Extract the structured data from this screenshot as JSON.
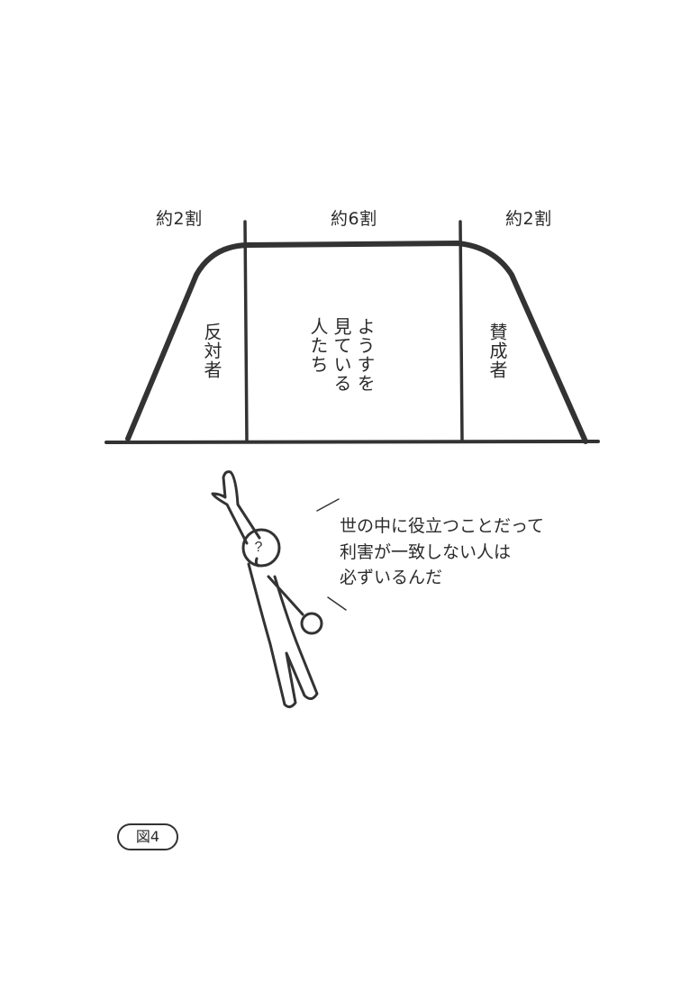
{
  "diagram": {
    "segments": [
      {
        "share_label": "約2割",
        "group_label": "反対者"
      },
      {
        "share_label": "約6割",
        "group_label": "ようすを\n見ている\n人たち"
      },
      {
        "share_label": "約2割",
        "group_label": "賛成者"
      }
    ]
  },
  "character": {
    "head_mark": "?",
    "speech_lines": [
      "世の中に役立つことだって",
      "利害が一致しない人は",
      "必ずいるんだ"
    ]
  },
  "figure_label": "図4"
}
